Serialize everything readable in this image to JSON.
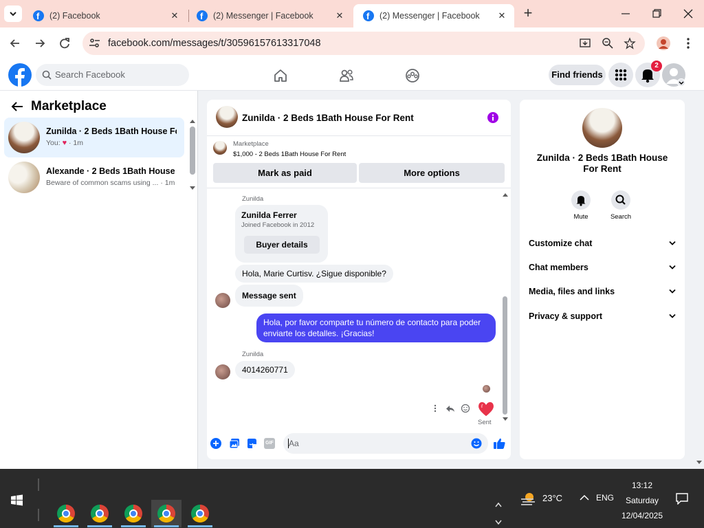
{
  "browser": {
    "tabs": [
      {
        "title": "(2) Facebook"
      },
      {
        "title": "(2) Messenger | Facebook"
      },
      {
        "title": "(2) Messenger | Facebook"
      }
    ],
    "url": "facebook.com/messages/t/30596157613317048",
    "new_tab": "+",
    "close_tab": "✕"
  },
  "fb": {
    "search_placeholder": "Search Facebook",
    "find_friends": "Find friends",
    "notification_count": "2"
  },
  "left": {
    "title": "Marketplace",
    "conversations": [
      {
        "title": "Zunilda · 2 Beds 1Bath House Fo...",
        "subtitle_prefix": "You:",
        "time": "· 1m"
      },
      {
        "title": "Alexande · 2 Beds 1Bath House ...",
        "subtitle_prefix": "Beware of common scams using ...",
        "time": "· 1m"
      }
    ]
  },
  "chat": {
    "title": "Zunilda · 2 Beds 1Bath House For Rent",
    "listing_source": "Marketplace",
    "listing_detail": "$1,000 - 2 Beds 1Bath House For Rent",
    "mark_paid": "Mark as paid",
    "more_options": "More options",
    "sender_name_short": "Zunilda",
    "profile_name": "Zunilda Ferrer",
    "profile_joined": "Joined Facebook in 2012",
    "buyer_details": "Buyer details",
    "msg1": "Hola, Marie Curtisv. ¿Sigue disponible?",
    "msg2": "Message sent",
    "msg_out": "Hola, por favor comparte tu número de contacto para poder enviarte los detalles. ¡Gracias!",
    "msg3": "4014260771",
    "sent_label": "Sent",
    "composer_placeholder": "Aa",
    "outgoing_color": "#4a45f2"
  },
  "info": {
    "name": "Zunilda · 2 Beds 1Bath House For Rent",
    "mute": "Mute",
    "search": "Search",
    "sections": [
      "Customize chat",
      "Chat members",
      "Media, files and links",
      "Privacy & support"
    ]
  },
  "taskbar": {
    "temperature": "23°C",
    "language": "ENG",
    "time": "13:12",
    "day": "Saturday",
    "date": "12/04/2025"
  },
  "colors": {
    "brand": "#1877f2",
    "tabstrip": "#fbdcd6",
    "omnibox": "#fce8e4"
  }
}
